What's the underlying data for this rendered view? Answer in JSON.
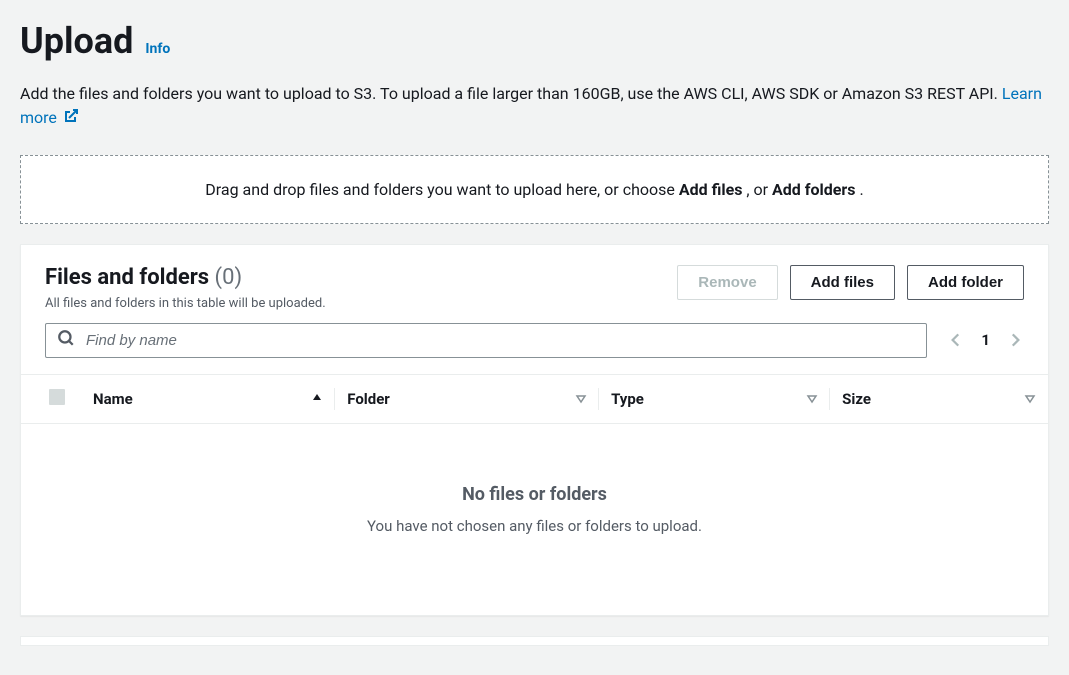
{
  "header": {
    "title": "Upload",
    "info_label": "Info"
  },
  "description": {
    "text_before": "Add the files and folders you want to upload to S3. To upload a file larger than 160GB, use the AWS CLI, AWS SDK or Amazon S3 REST API. ",
    "learn_more": "Learn more"
  },
  "dropzone": {
    "text_before": "Drag and drop files and folders you want to upload here, or choose ",
    "add_files": "Add files",
    "mid": ", or ",
    "add_folders": "Add folders",
    "after": "."
  },
  "panel": {
    "heading": "Files and folders",
    "count": "(0)",
    "subheading": "All files and folders in this table will be uploaded.",
    "buttons": {
      "remove": "Remove",
      "add_files": "Add files",
      "add_folder": "Add folder"
    },
    "search_placeholder": "Find by name",
    "page": "1",
    "columns": {
      "name": "Name",
      "folder": "Folder",
      "type": "Type",
      "size": "Size"
    },
    "empty": {
      "title": "No files or folders",
      "sub": "You have not chosen any files or folders to upload."
    }
  }
}
